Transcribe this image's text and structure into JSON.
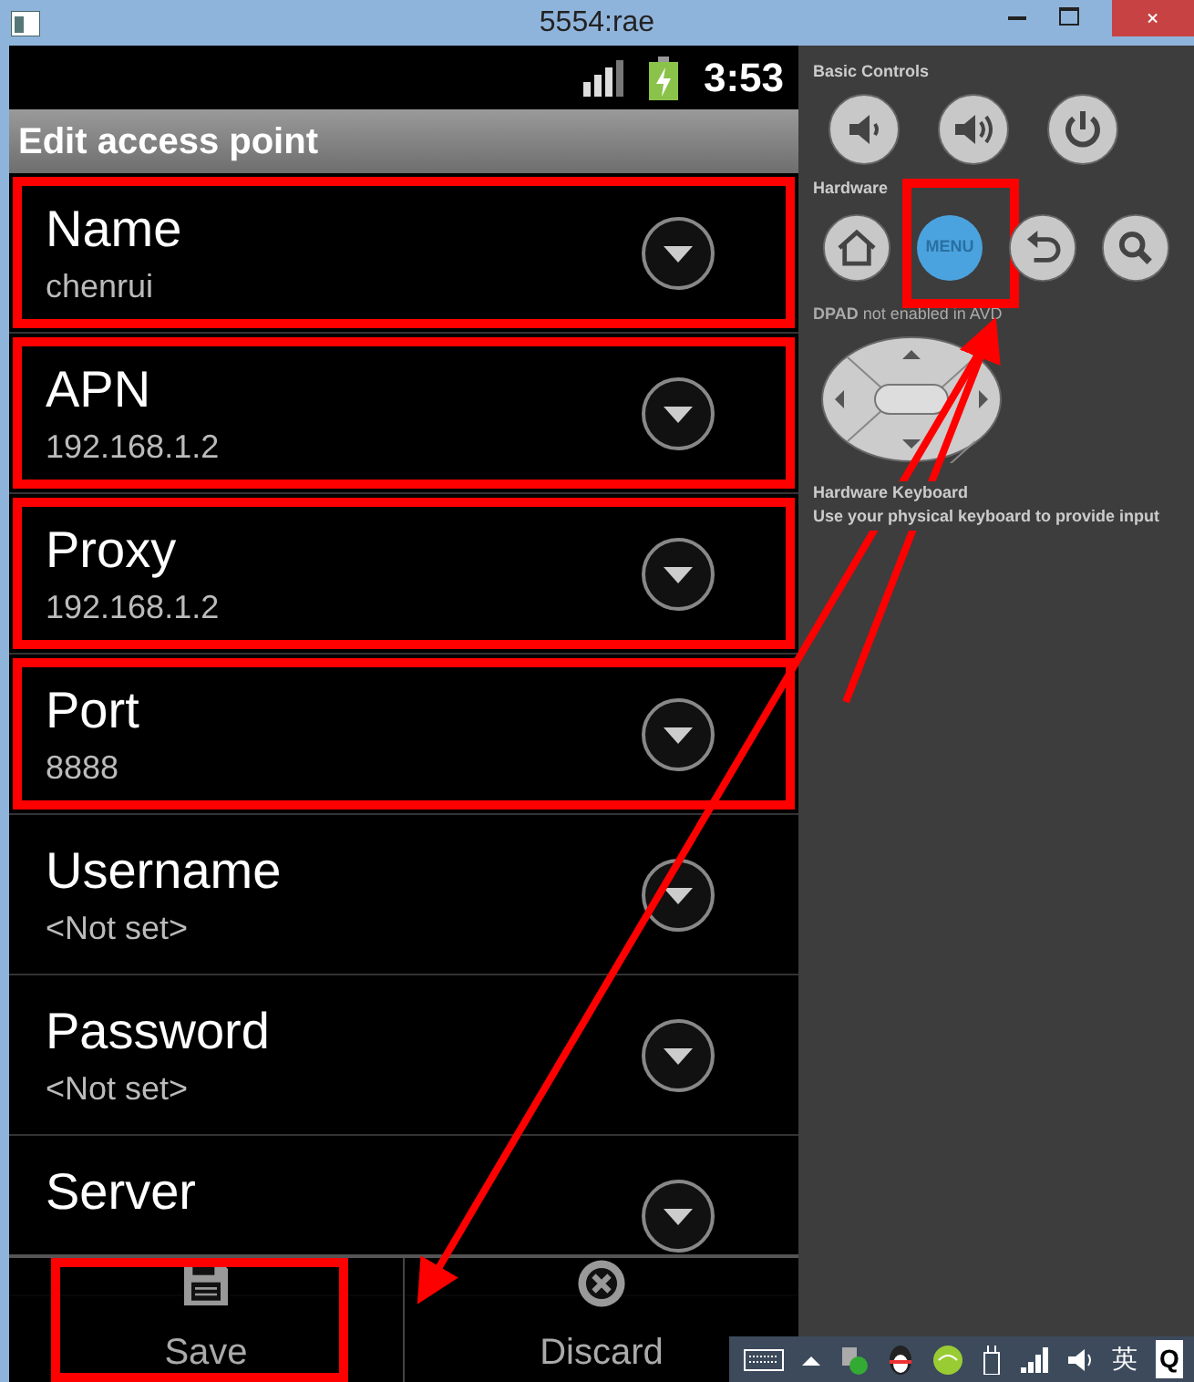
{
  "window": {
    "title": "5554:rae"
  },
  "status_bar": {
    "time": "3:53"
  },
  "screen_title": "Edit access point",
  "fields": [
    {
      "label": "Name",
      "value": "chenrui",
      "highlighted": true
    },
    {
      "label": "APN",
      "value": "192.168.1.2",
      "highlighted": true
    },
    {
      "label": "Proxy",
      "value": "192.168.1.2",
      "highlighted": true
    },
    {
      "label": "Port",
      "value": "8888",
      "highlighted": true
    },
    {
      "label": "Username",
      "value": "<Not set>",
      "highlighted": false
    },
    {
      "label": "Password",
      "value": "<Not set>",
      "highlighted": false
    },
    {
      "label": "Server",
      "highlighted": false
    }
  ],
  "menu": [
    {
      "kind": "save",
      "label": "Save",
      "highlighted": true
    },
    {
      "kind": "discard",
      "label": "Discard",
      "highlighted": false
    }
  ],
  "controls_panel": {
    "basic_controls": {
      "title": "Basic Controls",
      "buttons": [
        {
          "kind": "volume-down"
        },
        {
          "kind": "volume-up"
        },
        {
          "kind": "power"
        }
      ]
    },
    "hardware_buttons": {
      "title": "Hardware",
      "buttons": [
        {
          "kind": "home",
          "highlighted": false
        },
        {
          "kind": "menu",
          "label": "MENU",
          "highlighted": true
        },
        {
          "kind": "back",
          "highlighted": false
        },
        {
          "kind": "search",
          "highlighted": false
        }
      ]
    },
    "dpad_note": "**DPAD** not enabled in AVD",
    "keyboard_title": "Hardware Keyboard",
    "keyboard_note": "Use your physical keyboard to provide input"
  },
  "taskbar": {
    "language": "英",
    "search": "Q"
  }
}
